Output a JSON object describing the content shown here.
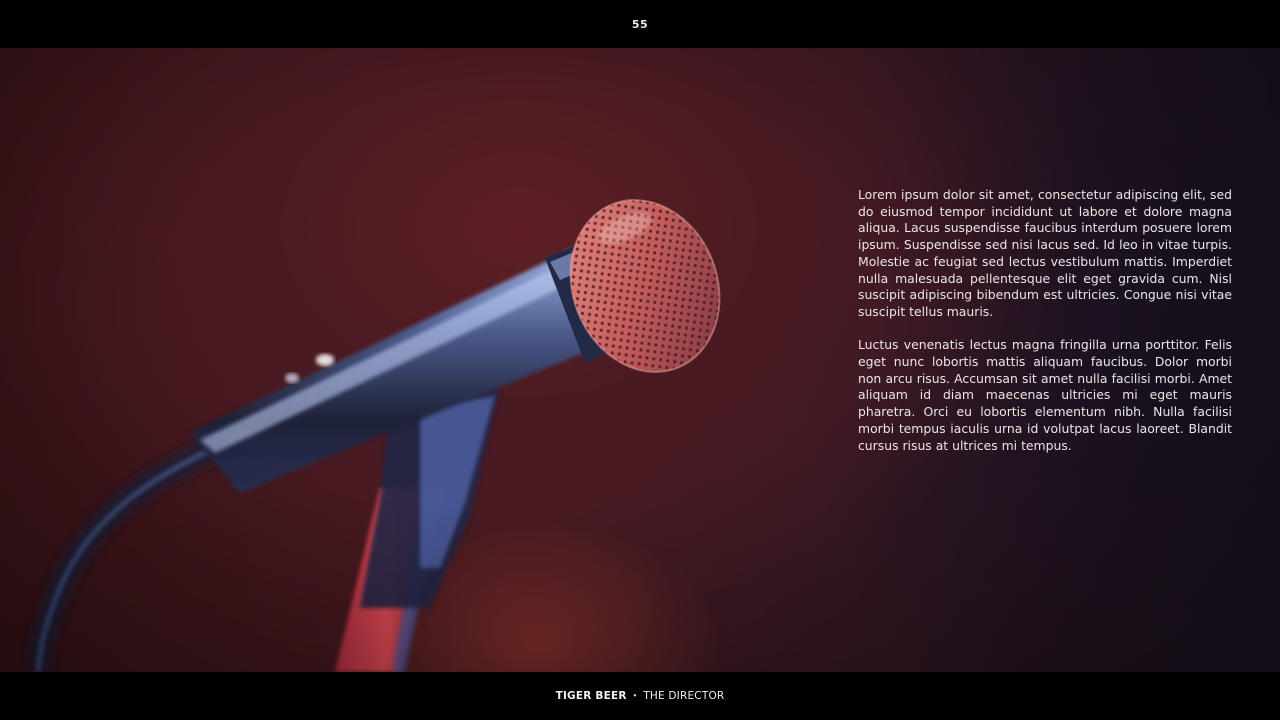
{
  "page": {
    "number": "55"
  },
  "body": {
    "paragraphs": [
      "Lorem ipsum dolor sit amet, consectetur adipiscing elit, sed do eiusmod tempor incididunt ut labore et dolore magna aliqua. Lacus suspendisse faucibus interdum posuere lorem ipsum. Suspendisse sed nisi lacus sed. Id leo in vitae turpis. Molestie ac feugiat sed lectus vestibulum mattis. Imperdiet nulla malesuada pellentesque elit eget gravida cum. Nisl suscipit adipiscing bibendum est ultricies. Congue nisi vitae suscipit tellus mauris.",
      "Luctus venenatis lectus magna fringilla urna porttitor. Felis eget nunc lobortis mattis aliquam faucibus. Dolor morbi non arcu risus. Accumsan sit amet nulla facilisi morbi. Amet aliquam id diam maecenas ultricies mi eget mauris pharetra. Orci eu lobortis elementum nibh. Nulla facilisi morbi tempus iaculis urna id volutpat lacus laoreet. Blandit cursus risus at ultrices mi tempus."
    ]
  },
  "footer": {
    "left": "TIGER BEER",
    "separator": "•",
    "right": "THE DIRECTOR"
  }
}
